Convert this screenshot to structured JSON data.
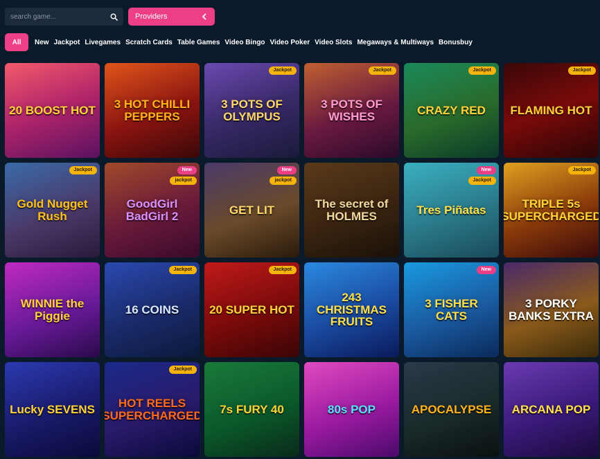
{
  "search": {
    "placeholder": "search game..."
  },
  "providers": {
    "label": "Providers"
  },
  "tabs": [
    "All",
    "New",
    "Jackpot",
    "Livegames",
    "Scratch Cards",
    "Table Games",
    "Video Bingo",
    "Video Poker",
    "Video Slots",
    "Megaways & Multiways",
    "Bonusbuy"
  ],
  "games": [
    {
      "title": "20 BOOST HOT",
      "bg": "linear-gradient(160deg,#f25a6a 0%,#b0246a 50%,#5a1260 100%)",
      "color": "#ffd23a",
      "badges": []
    },
    {
      "title": "3 HOT CHILLI PEPPERS",
      "bg": "linear-gradient(160deg,#e0551a 0%,#8a1410 55%,#3a0808 100%)",
      "color": "#ffb21a",
      "badges": []
    },
    {
      "title": "3 POTS OF OLYMPUS",
      "bg": "linear-gradient(160deg,#6a4ab0 0%,#3a2a6a 50%,#1a1a3a 100%)",
      "color": "#ffd86a",
      "badges": [
        "Jackpot"
      ]
    },
    {
      "title": "3 POTS OF WISHES",
      "bg": "linear-gradient(160deg,#c06030 0%,#6a1a40 55%,#2a0a2a 100%)",
      "color": "#ff9ad0",
      "badges": [
        "Jackpot"
      ]
    },
    {
      "title": "CRAZY RED",
      "bg": "linear-gradient(160deg,#1a8a5a 0%,#2a6a2a 55%,#0a3a2a 100%)",
      "color": "#ffd23a",
      "badges": [
        "Jackpot"
      ]
    },
    {
      "title": "FLAMING HOT",
      "bg": "linear-gradient(160deg,#3a0808 0%,#7a0a0a 50%,#2a0505 100%)",
      "color": "#ffd23a",
      "badges": [
        "Jackpot"
      ]
    },
    {
      "title": "Gold Nugget Rush",
      "bg": "linear-gradient(160deg,#3a6aa8 0%,#4a3a6a 55%,#2a1a3a 100%)",
      "color": "#ffc21a",
      "badges": [
        "Jackpot"
      ]
    },
    {
      "title": "GoodGirl BadGirl 2",
      "bg": "linear-gradient(160deg,#a04a2a 0%,#6a1a3a 55%,#3a0a2a 100%)",
      "color": "#d890ff",
      "badges": [
        "New",
        "jackpot"
      ]
    },
    {
      "title": "GET LIT",
      "bg": "linear-gradient(160deg,#4a3a6a 0%,#6a4a2a 55%,#2a1a0a 100%)",
      "color": "#ffd86a",
      "badges": [
        "New",
        "jackpot"
      ]
    },
    {
      "title": "The secret of HOLMES",
      "bg": "linear-gradient(160deg,#5a3a1a 0%,#3a2410 55%,#1a1008 100%)",
      "color": "#f0d8a0",
      "badges": []
    },
    {
      "title": "Tres Piñatas",
      "bg": "linear-gradient(160deg,#3ab0c0 0%,#2a7a8a 55%,#1a4a5a 100%)",
      "color": "#ffe04a",
      "badges": [
        "New",
        "Jackpot"
      ]
    },
    {
      "title": "TRIPLE 5s SUPERCHARGED",
      "bg": "linear-gradient(160deg,#e0a020 0%,#8a3a0a 55%,#3a0a0a 100%)",
      "color": "#ffd23a",
      "badges": [
        "Jackpot"
      ]
    },
    {
      "title": "WINNIE the Piggie",
      "bg": "linear-gradient(160deg,#c02ac0 0%,#6a1a9a 55%,#2a0a4a 100%)",
      "color": "#ffd23a",
      "badges": []
    },
    {
      "title": "16 COINS",
      "bg": "linear-gradient(160deg,#2a4ab0 0%,#1a2a6a 55%,#0a1a3a 100%)",
      "color": "#d8e6ff",
      "badges": [
        "Jackpot"
      ]
    },
    {
      "title": "20 SUPER HOT",
      "bg": "linear-gradient(160deg,#c01a1a 0%,#7a0a0a 55%,#3a0505 100%)",
      "color": "#ffd23a",
      "badges": [
        "Jackpot"
      ]
    },
    {
      "title": "243 CHRISTMAS FRUITS",
      "bg": "linear-gradient(160deg,#2a8ae0 0%,#1a4aa0 55%,#0a1a5a 100%)",
      "color": "#ffe04a",
      "badges": []
    },
    {
      "title": "3 FISHER CATS",
      "bg": "linear-gradient(160deg,#1a9ae0 0%,#1a5aa0 55%,#0a2a5a 100%)",
      "color": "#ffe04a",
      "badges": [
        "New"
      ]
    },
    {
      "title": "3 PORKY BANKS EXTRA",
      "bg": "linear-gradient(160deg,#4a2a6a 0%,#8a5a1a 55%,#3a2a0a 100%)",
      "color": "#ffffff",
      "badges": []
    },
    {
      "title": "Lucky SEVENS",
      "bg": "linear-gradient(160deg,#2a3ab0 0%,#1a1a6a 55%,#0a0a3a 100%)",
      "color": "#ffd23a",
      "badges": []
    },
    {
      "title": "HOT REELS SUPERCHARGED",
      "bg": "linear-gradient(160deg,#1a2a8a 0%,#2a1a6a 55%,#0a0a3a 100%)",
      "color": "#ff6a1a",
      "badges": [
        "Jackpot"
      ]
    },
    {
      "title": "7s FURY 40",
      "bg": "linear-gradient(160deg,#1a7a3a 0%,#0a5a2a 55%,#0a2a1a 100%)",
      "color": "#ffd23a",
      "badges": []
    },
    {
      "title": "80s POP",
      "bg": "linear-gradient(160deg,#e04ac0 0%,#9a1aa0 55%,#4a0a6a 100%)",
      "color": "#5ae0ff",
      "badges": []
    },
    {
      "title": "APOCALYPSE",
      "bg": "linear-gradient(160deg,#2a3a4a 0%,#1a2a2a 55%,#0a1010 100%)",
      "color": "#ffb21a",
      "badges": []
    },
    {
      "title": "ARCANA POP",
      "bg": "linear-gradient(160deg,#6a3ab0 0%,#3a1a7a 55%,#1a0a3a 100%)",
      "color": "#ffe04a",
      "badges": []
    }
  ]
}
